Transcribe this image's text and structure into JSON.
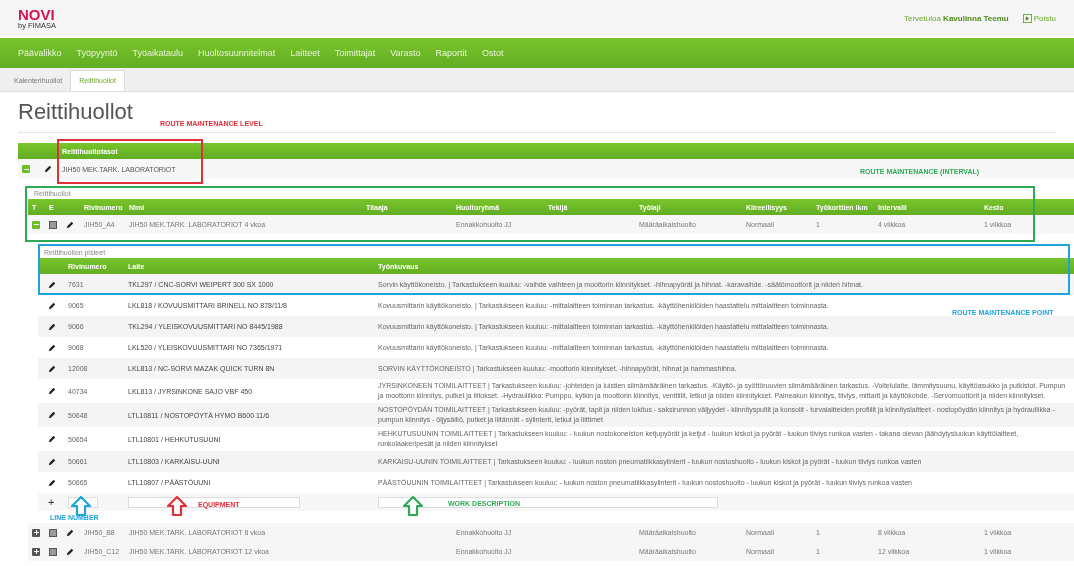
{
  "header": {
    "logo": "NOVI",
    "logo_sub": "by FIMASA",
    "welcome": "Tervetuloa **Kavulinna Teemu**",
    "logout": "Poistu"
  },
  "nav": [
    "Päävalikko",
    "Työpyyntö",
    "Työaikataulu",
    "Huoltosuunnitelmat",
    "Laitteet",
    "Toimittajat",
    "Varasto",
    "Raportit",
    "Ostot"
  ],
  "subtabs": [
    {
      "label": "Kalenterihuollot",
      "selected": false
    },
    {
      "label": "Reittihuollot",
      "selected": true
    }
  ],
  "title": "Reittihuollot",
  "levels": {
    "column": "Reittihuoltotasot",
    "rows": [
      {
        "name": "JIH50 MEK.TARK. LABORATORIOT",
        "expanded": true
      }
    ]
  },
  "routes": {
    "caption": "Reittihuollot",
    "columns": [
      "T",
      "E",
      "Rivinumero",
      "Nimi",
      "Tilaaja",
      "Huoltoryhmä",
      "Tekijä",
      "Työlaji",
      "Kiireellisyys",
      "Työkorttien lkm",
      "Intervalli",
      "Kesto"
    ],
    "rows": [
      {
        "expanded": true,
        "number": "JIH50_A4",
        "name": "JIH50 MEK.TARK. LABORATORIOT 4 vkoa",
        "group": "Ennakkohuolto JJ",
        "worktype": "Määräaikaishuolto",
        "urgency": "Normaali",
        "cards": "1",
        "interval": "4 viikkoa",
        "duration": "1 viikkoa"
      },
      {
        "expanded": false,
        "number": "JIH50_B8",
        "name": "JIH50 MEK.TARK. LABORATORIOT 8 vkoa",
        "group": "Ennakkohuolto JJ",
        "worktype": "Määräaikaishuolto",
        "urgency": "Normaali",
        "cards": "1",
        "interval": "8 viikkoa",
        "duration": "1 viikkoa"
      },
      {
        "expanded": false,
        "number": "JIH50_C12",
        "name": "JIH50 MEK.TARK. LABORATORIOT 12 vkoa",
        "group": "Ennakkohuolto JJ",
        "worktype": "Määräaikaishuolto",
        "urgency": "Normaali",
        "cards": "1",
        "interval": "12 viikkoa",
        "duration": "1 viikkoa"
      }
    ]
  },
  "points": {
    "caption": "Reittihuollon pisteet",
    "columns": [
      "Rivinumero",
      "Laite",
      "Työnkuvaus"
    ],
    "rows": [
      {
        "number": "7631",
        "device": "TKL297 / CNC-SORVI WEIPERT 300 SX 1000",
        "work": "Sorvin käyttökoneisto. | Tarkastukseen kuuluu: -vaihde vaihteen ja moottorin kiinnitykset. -hihnapyörät ja hihnat. -karavaihde. -säätömoottorit ja niiden hihnat."
      },
      {
        "number": "9065",
        "device": "LKL818 / KOVUUSMITTARI BRINELL NO 878/11/8",
        "work": "Kovuusmittarin käyttökoneisto. | Tarkastukseen kuuluu: -mittalaitteen toiminnan tarkastus. -käyttöhenkilöiden haastattelu mittalaitteen toiminnasta."
      },
      {
        "number": "9066",
        "device": "TKL294 / YLEISKOVUUSMITTARI NO 8445/1988",
        "work": "Kovuusmittarin käyttökoneisto. | Tarkastukseen kuuluu: -mittalaitteen toiminnan tarkastus. -käyttöhenkilöiden haastattelu mittalaitteen toiminnasta."
      },
      {
        "number": "9068",
        "device": "LKL520 / YLEISKOVUUSMITTARI NO 7365/1971",
        "work": "Kovuusmittarin käyttökoneisto. | Tarkastukseen kuuluu: -mittalaitteen toiminnan tarkastus. -käyttöhenkilöiden haastattelu mittalaitteen toiminnasta."
      },
      {
        "number": "12008",
        "device": "LKL813 / NC-SORVI MAZAK QUICK TURN 8N",
        "work": "SORVIN KÄYTTÖKONEISTO | Tarkastukseen kuuluu: -moottorin kiinnitykset. -hihnapyörät, hihnat ja hammashihna."
      },
      {
        "number": "40734",
        "device": "LKL813 / JYRSINKONE SAJO VBF 450",
        "work": "JYRSINKONEEN TOIMILAITTEET | Tarkastukseen kuuluu: -johteiden ja luistien silmämääräinen tarkastus. -Käyttö- ja syöttöruuvien silmämääräinen tarkastus. -Voitelulaite, lämmitysuunu, käyttöasukko ja putkistot. Pumpun ja moottorin kiinnitys, putket ja liitokset. -Hydrauliikka: Pumppu, kytkin ja moottorin kiinnitys, venttiilit, letkut ja niiden kiinnitykset. Paineakun kiinnitys, tiiviys, mittarit ja käyttökohde. -Servomoottorit ja niiden kiinnitykset."
      },
      {
        "number": "50648",
        "device": "LTL10811 / NOSTOPÖYTÄ HYMO B600 11/6",
        "work": "NOSTOPÖYDÄN TOIMILAITTEET | Tarkastukseen kuuluu: -pyörät, tapit ja niiden lukitus - saksirunnon väljyydet - kiinnityspultit ja konsolit - turvalaitteiden profiilit ja kiinnityslaitteet - nostopöydän kiinnitys ja hydrauliikka - pumpun kiinnitys - öljysäiliö, putket ja liitännät - sylinterit, letkut ja liittimet"
      },
      {
        "number": "50654",
        "device": "LTL10801 / HEHKUTUSUUNI",
        "work": "HEHKUTUSUUNIN TOIMILAITTEET | Tarkastukseen kuuluu: - luukun nostokoneiston ketjupyörät ja ketjut - luukun kiskot ja pyörät - luukun tiiviys runkoa vasten - takana olevan jäähdytysluukun käyttölaitteet, runkolaakeripesät ja niiden kiinnitykset"
      },
      {
        "number": "50661",
        "device": "LTL10803 / KARKAISU-UUNI",
        "work": "KARKAISU-UUNIN TOIMILAITTEET | Tarkastukseen kuuluu: - luukun noston pneumatiikkasylinterit - luukun nostoshuolto - luukun kiskot ja pyörät - luukun tiiviys runkoa vasten"
      },
      {
        "number": "50665",
        "device": "LTL10807 / PÄÄSTÖUUNI",
        "work": "PÄÄSTÖUUNIN TOIMILAITTEET | Tarkastukseen kuuluu: - luukun noston pneumatiikkasylinterit - luukun nostoshuolto - luukun kiskot ja pyörät - luukun tiiviys runkoa vasten"
      }
    ],
    "add_row": {
      "add": "+"
    }
  },
  "annotations": [
    {
      "kind": "box",
      "text": "ROUTE MAINTENANCE LEVEL",
      "color": "#e0303a"
    },
    {
      "kind": "box",
      "text": "ROUTE MAINTENANCE (INTERVAL)",
      "color": "#2eaa55"
    },
    {
      "kind": "box",
      "text": "ROUTE MAINTENANCE POINT",
      "color": "#1fa3dc"
    },
    {
      "kind": "arrow",
      "text": "LINE NUMBER",
      "color": "#1fa3dc"
    },
    {
      "kind": "arrow",
      "text": "EQUIPMENT",
      "color": "#e0303a"
    },
    {
      "kind": "arrow",
      "text": "WORK DESCRIPTION",
      "color": "#2eaa55"
    }
  ]
}
